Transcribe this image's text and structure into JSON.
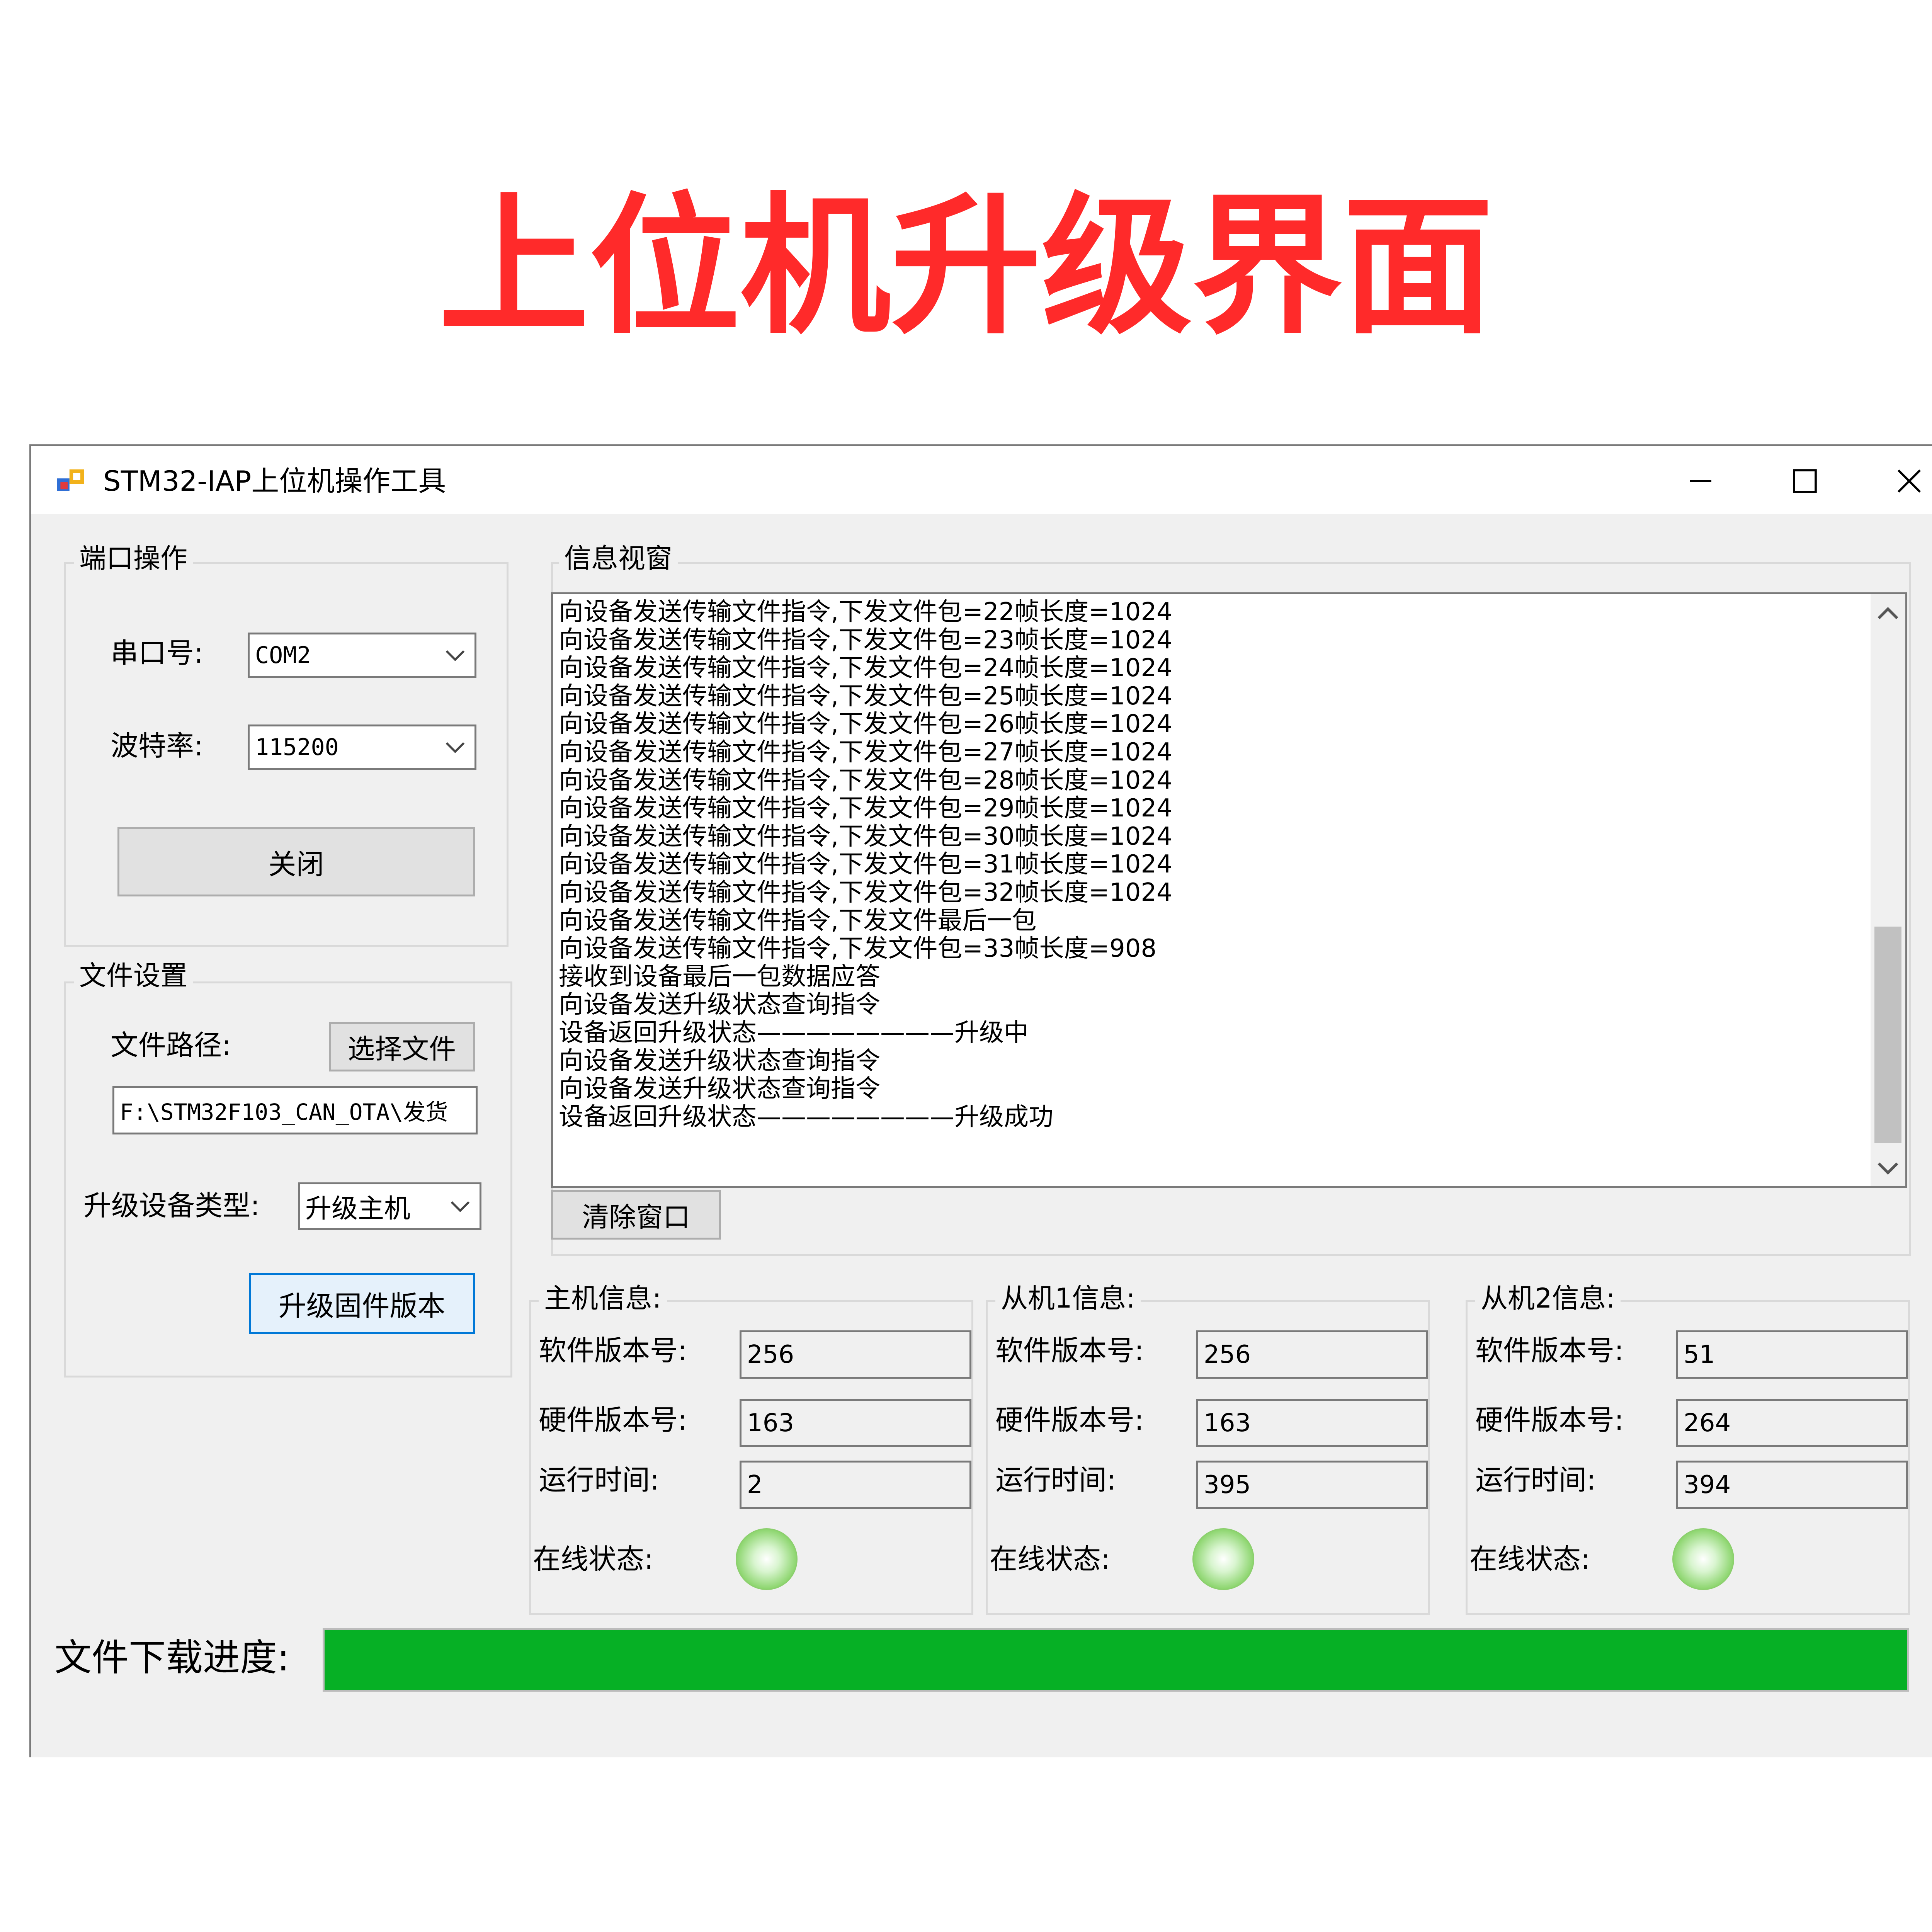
{
  "headline": "上位机升级界面",
  "window": {
    "title": "STM32-IAP上位机操作工具",
    "controls": {
      "minimize": "—",
      "maximize": "☐",
      "close": "✕"
    }
  },
  "port": {
    "legend": "端口操作",
    "serial_label": "串口号:",
    "serial_value": "COM2",
    "baud_label": "波特率:",
    "baud_value": "115200",
    "close_button": "关闭"
  },
  "file": {
    "legend": "文件设置",
    "path_label": "文件路径:",
    "choose_button": "选择文件",
    "path_value": "F:\\STM32F103_CAN_OTA\\发货",
    "device_type_label": "升级设备类型:",
    "device_type_value": "升级主机",
    "upgrade_button": "升级固件版本"
  },
  "info": {
    "legend": "信息视窗",
    "log": [
      "向设备发送传输文件指令,下发文件包=22帧长度=1024",
      "向设备发送传输文件指令,下发文件包=23帧长度=1024",
      "向设备发送传输文件指令,下发文件包=24帧长度=1024",
      "向设备发送传输文件指令,下发文件包=25帧长度=1024",
      "向设备发送传输文件指令,下发文件包=26帧长度=1024",
      "向设备发送传输文件指令,下发文件包=27帧长度=1024",
      "向设备发送传输文件指令,下发文件包=28帧长度=1024",
      "向设备发送传输文件指令,下发文件包=29帧长度=1024",
      "向设备发送传输文件指令,下发文件包=30帧长度=1024",
      "向设备发送传输文件指令,下发文件包=31帧长度=1024",
      "向设备发送传输文件指令,下发文件包=32帧长度=1024",
      "向设备发送传输文件指令,下发文件最后一包",
      "向设备发送传输文件指令,下发文件包=33帧长度=908",
      "接收到设备最后一包数据应答",
      "向设备发送升级状态查询指令",
      "设备返回升级状态————————升级中",
      "向设备发送升级状态查询指令",
      "向设备发送升级状态查询指令",
      "设备返回升级状态————————升级成功"
    ],
    "clear_button": "清除窗口"
  },
  "devices": [
    {
      "legend": "主机信息:",
      "sw_label": "软件版本号:",
      "sw": "256",
      "hw_label": "硬件版本号:",
      "hw": "163",
      "rt_label": "运行时间:",
      "rt": "2",
      "online_label": "在线状态:"
    },
    {
      "legend": "从机1信息:",
      "sw_label": "软件版本号:",
      "sw": "256",
      "hw_label": "硬件版本号:",
      "hw": "163",
      "rt_label": "运行时间:",
      "rt": "395",
      "online_label": "在线状态:"
    },
    {
      "legend": "从机2信息:",
      "sw_label": "软件版本号:",
      "sw": "51",
      "hw_label": "硬件版本号:",
      "hw": "264",
      "rt_label": "运行时间:",
      "rt": "394",
      "online_label": "在线状态:"
    }
  ],
  "progress": {
    "label": "文件下载进度:",
    "fraction": 1.0,
    "color": "#06b025"
  },
  "colors": {
    "headline": "#ff2a2a",
    "window_bg": "#f0f0f0",
    "led": "#8ed670"
  }
}
